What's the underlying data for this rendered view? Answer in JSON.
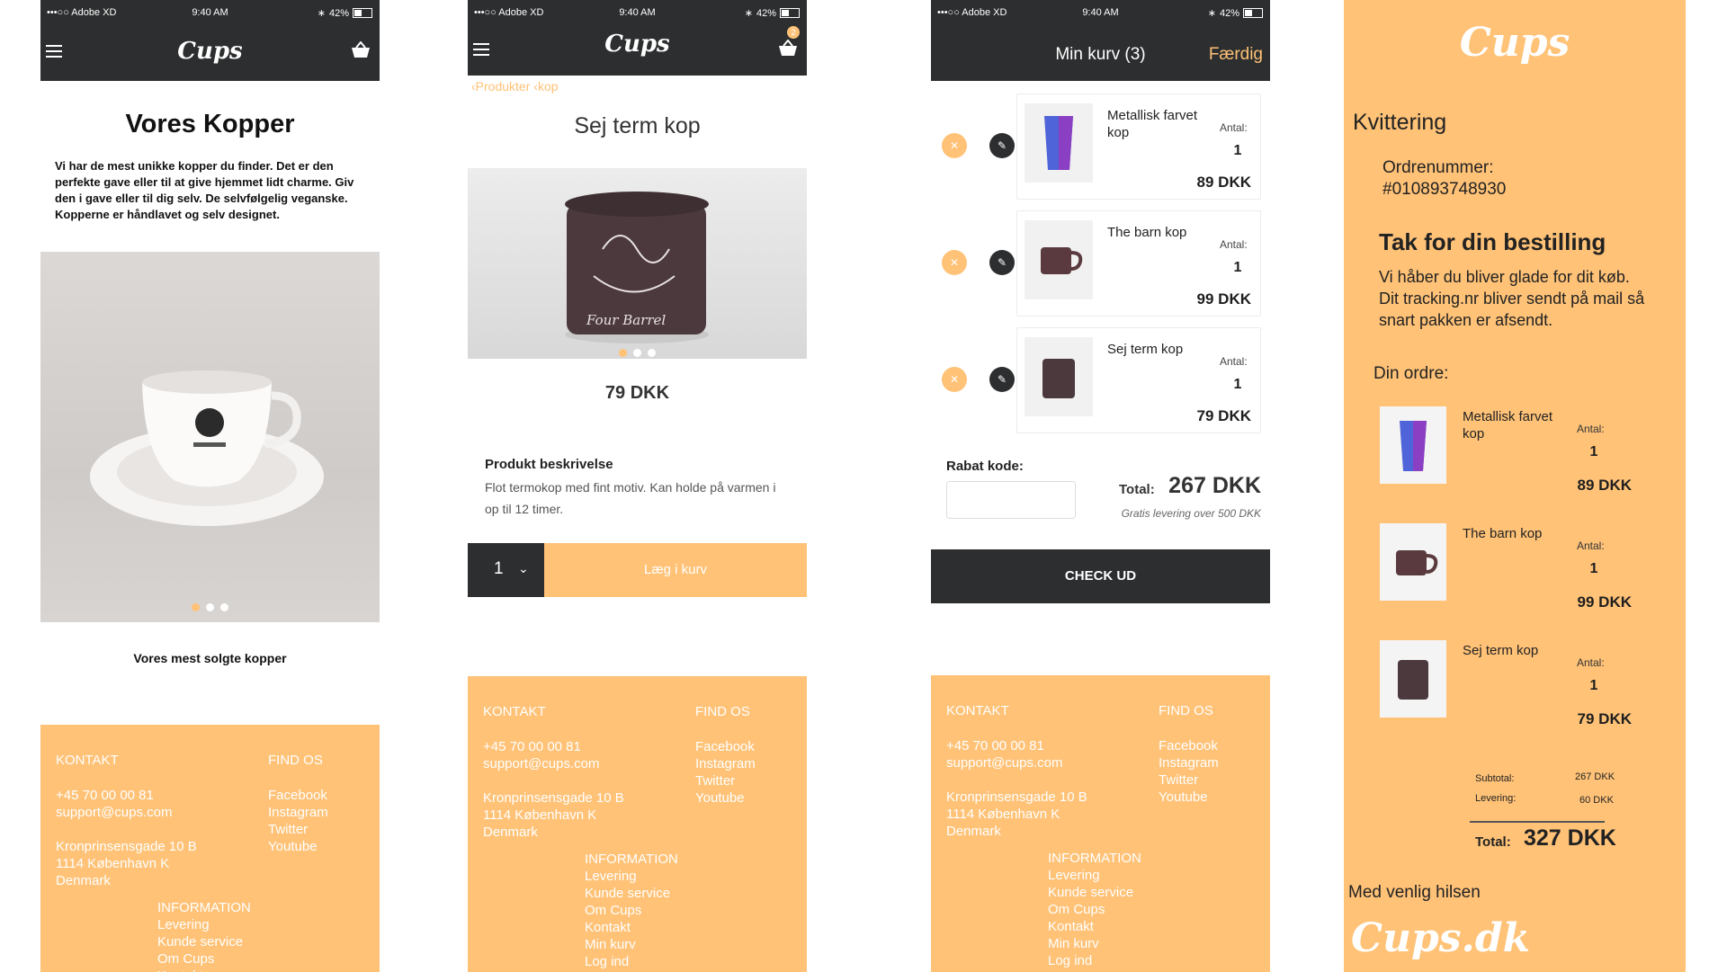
{
  "status": {
    "carrier": "•••○○ Adobe XD",
    "time": "9:40 AM",
    "battery": "42%"
  },
  "brand": {
    "logo": "Cups",
    "logo_dk": "Cups.dk",
    "accent": "#ffc277",
    "dark": "#2c2e2f"
  },
  "home": {
    "title": "Vores Kopper",
    "intro": "Vi har de mest unikke kopper du finder. Det er den perfekte gave eller til at give hjemmet lidt charme. Giv den i gave eller til dig selv. De selvfølgelig veganske. Kopperne er håndlavet og selv designet.",
    "bestsellers": "Vores mest solgte kopper"
  },
  "footer": {
    "contact_header": "KONTAKT",
    "phone": "+45 70 00 00 81",
    "email": "support@cups.com",
    "address1": "Kronprinsensgade 10 B",
    "address2": "1114 København K",
    "country": "Denmark",
    "find_header": "FIND OS",
    "social": [
      "Facebook",
      "Instagram",
      "Twitter",
      "Youtube"
    ],
    "info_header": "INFORMATION",
    "info": [
      "Levering",
      "Kunde service",
      "Om Cups",
      "Kontakt",
      "Min kurv",
      "Log ind"
    ]
  },
  "product": {
    "crumb1": "Produkter",
    "crumb2": "kop",
    "name": "Sej term kop",
    "price": "79 DKK",
    "desc_title": "Produkt beskrivelse",
    "desc": "Flot termokop med fint motiv. Kan holde på varmen i op til 12 timer.",
    "qty": "1",
    "add_label": "Læg i kurv",
    "cart_badge": "2",
    "mug_text": "Four Barrel"
  },
  "cart": {
    "title": "Min kurv (3)",
    "done": "Færdig",
    "antal_label": "Antal:",
    "items": [
      {
        "name": "Metallisk farvet kop",
        "qty": "1",
        "price": "89 DKK"
      },
      {
        "name": "The barn kop",
        "qty": "1",
        "price": "99 DKK"
      },
      {
        "name": "Sej term kop",
        "qty": "1",
        "price": "79 DKK"
      }
    ],
    "discount_label": "Rabat kode:",
    "discount_value": "",
    "total_label": "Total:",
    "total": "267 DKK",
    "shipping_note": "Gratis levering over 500 DKK",
    "checkout": "CHECK UD"
  },
  "receipt": {
    "title": "Kvittering",
    "order_label": "Ordrenummer:",
    "order_no": "#010893748930",
    "thanks": "Tak for din bestilling",
    "message": "Vi håber du bliver glade for dit køb. Dit tracking.nr  bliver sendt på mail  så snart pakken er afsendt.",
    "your_order": "Din ordre:",
    "items": [
      {
        "name": "Metallisk farvet kop",
        "qty": "1",
        "price": "89 DKK"
      },
      {
        "name": "The barn kop",
        "qty": "1",
        "price": "99 DKK"
      },
      {
        "name": "Sej term kop",
        "qty": "1",
        "price": "79 DKK"
      }
    ],
    "subtotal_label": "Subtotal:",
    "subtotal": "267 DKK",
    "delivery_label": "Levering:",
    "delivery": "60 DKK",
    "total_label": "Total:",
    "total": "327 DKK",
    "regards": "Med venlig hilsen"
  }
}
